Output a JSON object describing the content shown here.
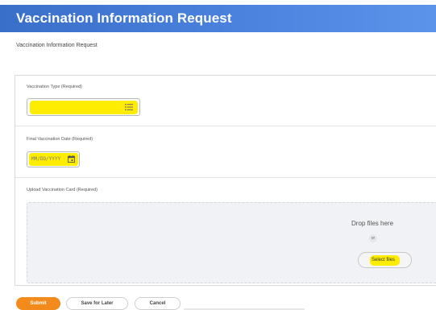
{
  "header": {
    "title": "Vaccination Information Request"
  },
  "subtitle": "Vaccination Information Request",
  "form": {
    "vaccination_type": {
      "label": "Vaccination Type (Required)",
      "value": ""
    },
    "final_date": {
      "label": "Final Vaccination Date (Required)",
      "placeholder": "MM/DD/YYYY"
    },
    "upload": {
      "label": "Upload Vaccination Card (Required)",
      "drop_text": "Drop files here",
      "or_text": "or",
      "select_files_label": "Select files"
    }
  },
  "footer": {
    "submit_label": "Submit",
    "save_label": "Save for Later",
    "cancel_label": "Cancel"
  },
  "colors": {
    "header_blue": "#4a82de",
    "highlight_yellow": "#ffed00",
    "submit_orange": "#f38b1c"
  },
  "icons": {
    "select_icon": "list-icon",
    "date_icon": "calendar-icon"
  }
}
